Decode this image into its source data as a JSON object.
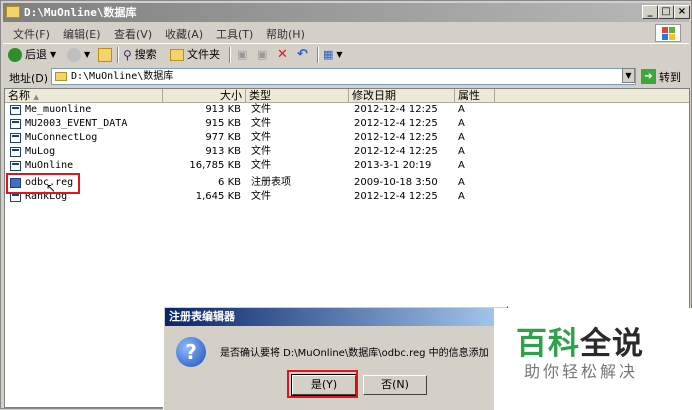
{
  "window": {
    "title": "D:\\MuOnline\\数据库",
    "controls": [
      "_",
      "□",
      "×"
    ]
  },
  "menu": [
    "文件(F)",
    "编辑(E)",
    "查看(V)",
    "收藏(A)",
    "工具(T)",
    "帮助(H)"
  ],
  "toolbar": {
    "back": "后退",
    "search": "搜索",
    "folders": "文件夹"
  },
  "address": {
    "label": "地址(D)",
    "value": "D:\\MuOnline\\数据库",
    "go": "转到"
  },
  "columns": [
    "名称",
    "大小",
    "类型",
    "修改日期",
    "属性"
  ],
  "files": [
    {
      "name": "Me_muonline",
      "size": "913 KB",
      "type": "文件",
      "date": "2012-12-4 12:25",
      "attr": "A",
      "icon": "file-icon"
    },
    {
      "name": "MU2003_EVENT_DATA",
      "size": "915 KB",
      "type": "文件",
      "date": "2012-12-4 12:25",
      "attr": "A",
      "icon": "file-icon"
    },
    {
      "name": "MuConnectLog",
      "size": "977 KB",
      "type": "文件",
      "date": "2012-12-4 12:25",
      "attr": "A",
      "icon": "file-icon"
    },
    {
      "name": "MuLog",
      "size": "913 KB",
      "type": "文件",
      "date": "2012-12-4 12:25",
      "attr": "A",
      "icon": "file-icon"
    },
    {
      "name": "MuOnline",
      "size": "16,785 KB",
      "type": "文件",
      "date": "2013-3-1 20:19",
      "attr": "A",
      "icon": "file-icon"
    },
    {
      "name": "odbc.reg",
      "size": "6 KB",
      "type": "注册表项",
      "date": "2009-10-18 3:50",
      "attr": "A",
      "icon": "registry-icon"
    },
    {
      "name": "RankLog",
      "size": "1,645 KB",
      "type": "文件",
      "date": "2012-12-4 12:25",
      "attr": "A",
      "icon": "file-icon"
    }
  ],
  "dialog": {
    "title": "注册表编辑器",
    "message": "是否确认要将 D:\\MuOnline\\数据库\\odbc.reg 中的信息添加",
    "yes": "是(Y)",
    "no": "否(N)"
  },
  "watermark": {
    "main_left": "百科",
    "main_right": "全说",
    "sub": "助你轻松解决"
  }
}
